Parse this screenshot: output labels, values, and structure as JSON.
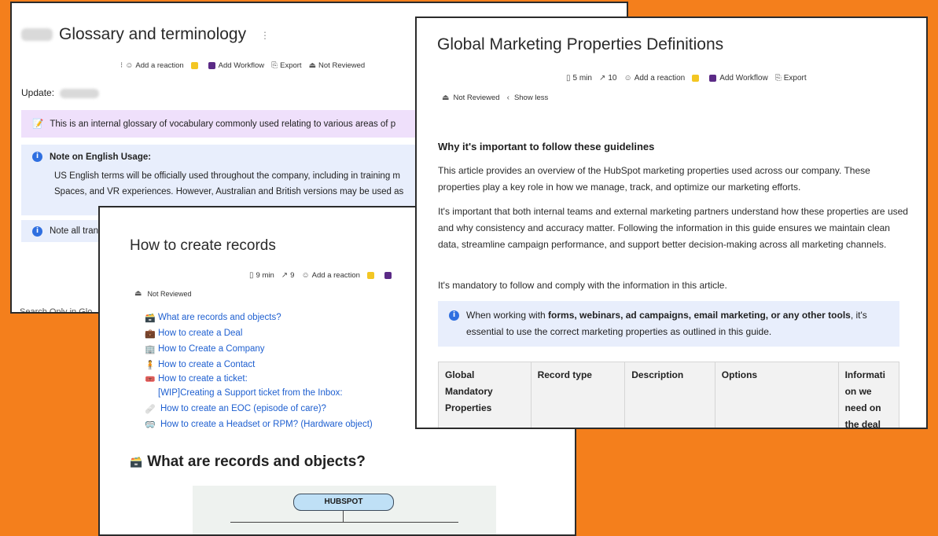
{
  "window1": {
    "title": "Glossary and terminology",
    "meta": {
      "reaction": "Add a reaction",
      "workflow": "Add Workflow",
      "export": "Export",
      "status": "Not Reviewed"
    },
    "update_label": "Update:",
    "purple_callout": "This is an internal glossary of vocabulary commonly used relating to various areas of p",
    "note_title": "Note on English Usage:",
    "note_line1": "US English terms will be officially used throughout the company, including in training m",
    "note_line2": "Spaces, and VR experiences. However, Australian and British versions may be used as",
    "note2": "Note all trans",
    "search": "Search Only in Glo"
  },
  "window2": {
    "title": "How to create records",
    "meta": {
      "read_time": "9 min",
      "views": "9",
      "reaction": "Add a reaction",
      "status": "Not Reviewed"
    },
    "links": [
      {
        "emoji": "🗃️",
        "label": "What are records and objects?"
      },
      {
        "emoji": "💼",
        "label": "How to create a Deal"
      },
      {
        "emoji": "🏢",
        "label": "How to Create a Company"
      },
      {
        "emoji": "🧍",
        "label": "How to create a Contact"
      },
      {
        "emoji": "🎟️",
        "label": "How to create a ticket:"
      },
      {
        "emoji": "",
        "label": "[WIP]Creating a Support ticket from the Inbox:"
      },
      {
        "emoji": "🩹",
        "label": "How to create an EOC (episode of care)?"
      },
      {
        "emoji": "🥽",
        "label": "How to create a Headset or RPM? (Hardware object)"
      }
    ],
    "heading": "What are records and objects?",
    "diagram_node": "HUBSPOT"
  },
  "window3": {
    "title": "Global Marketing Properties Definitions",
    "meta": {
      "read_time": "5 min",
      "views": "10",
      "reaction": "Add a reaction",
      "workflow": "Add Workflow",
      "export": "Export",
      "status": "Not Reviewed",
      "show_less": "Show less"
    },
    "heading": "Why it's important to follow these guidelines",
    "para1": "This article provides an overview of the HubSpot marketing properties used across our company. These properties play a key role in how we manage, track, and optimize our marketing efforts.",
    "para2": "It's important that both internal teams and external marketing partners understand how these properties are used and why consistency and accuracy matter. Following the information in this guide ensures we maintain clean data, streamline campaign performance, and support better decision-making across all marketing channels.",
    "para3": "It's mandatory to follow and comply with the information in this article.",
    "callout_pre": "When working with ",
    "callout_bold": "forms, webinars, ad campaigns, email marketing, or any other tools",
    "callout_post": ", it's essential to use the correct marketing properties as outlined in this guide.",
    "table_headers": [
      "Global Mandatory Properties",
      "Record type",
      "Description",
      "Options",
      "Informati on we need on the deal"
    ]
  },
  "colors": {
    "background": "#f47f1c",
    "link": "#1e5fd0",
    "info_callout": "#e8eefc",
    "purple_callout": "#efe0fb"
  }
}
